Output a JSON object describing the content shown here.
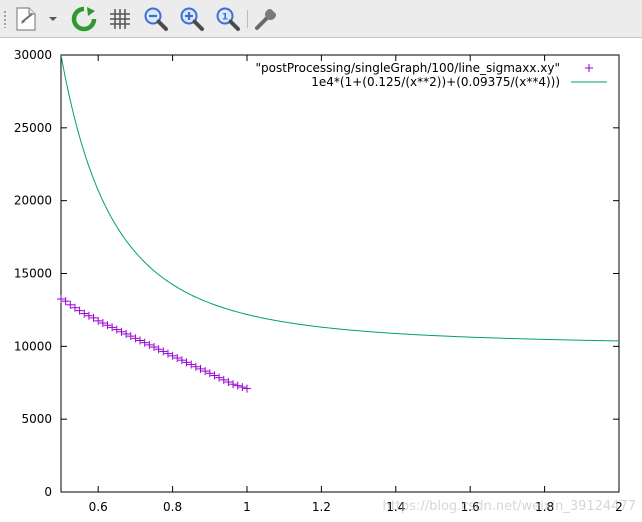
{
  "toolbar": {
    "buttons": [
      {
        "name": "export-button",
        "icon": "page-export-icon"
      },
      {
        "name": "export-menu-button",
        "icon": "chevron-down-icon"
      },
      {
        "name": "replot-button",
        "icon": "refresh-icon"
      },
      {
        "name": "grid-button",
        "icon": "grid-icon"
      },
      {
        "name": "zoom-out-button",
        "icon": "zoom-out-icon"
      },
      {
        "name": "zoom-in-button",
        "icon": "zoom-in-icon"
      },
      {
        "name": "zoom-reset-button",
        "icon": "zoom-reset-icon"
      },
      {
        "name": "settings-button",
        "icon": "wrench-icon"
      }
    ],
    "colors": {
      "refresh": "#2e9a2e",
      "zoom": "#3b6fd1"
    }
  },
  "watermark": "https://blog.csdn.net/weixin_39124477",
  "chart_data": {
    "type": "scatter",
    "xlim": [
      0.5,
      2.0
    ],
    "ylim": [
      0,
      30000
    ],
    "xticks": [
      0.6,
      0.8,
      1.0,
      1.2,
      1.4,
      1.6,
      1.8,
      2.0
    ],
    "xtick_labels": [
      "0.6",
      "0.8",
      "1",
      "1.2",
      "1.4",
      "1.6",
      "1.8",
      "2"
    ],
    "yticks": [
      0,
      5000,
      10000,
      15000,
      20000,
      25000,
      30000
    ],
    "ytick_labels": [
      "0",
      "5000",
      "10000",
      "15000",
      "20000",
      "25000",
      "30000"
    ],
    "grid": false,
    "legend_position": "top-right",
    "series": [
      {
        "name": "\"postProcessing/singleGraph/100/line_sigmaxx.xy\"",
        "kind": "points",
        "marker": "plus",
        "color": "#9400d3",
        "x": [
          0.5,
          0.5125,
          0.525,
          0.5375,
          0.55,
          0.5625,
          0.575,
          0.5875,
          0.6,
          0.6125,
          0.625,
          0.6375,
          0.65,
          0.6625,
          0.675,
          0.6875,
          0.7,
          0.7125,
          0.725,
          0.7375,
          0.75,
          0.7625,
          0.775,
          0.7875,
          0.8,
          0.8125,
          0.825,
          0.8375,
          0.85,
          0.8625,
          0.875,
          0.8875,
          0.9,
          0.9125,
          0.925,
          0.9375,
          0.95,
          0.9625,
          0.975,
          0.9875,
          1.0
        ],
        "y": [
          13250,
          13100,
          12850,
          12650,
          12450,
          12250,
          12100,
          11950,
          11750,
          11600,
          11450,
          11300,
          11150,
          11000,
          10850,
          10700,
          10550,
          10400,
          10250,
          10100,
          9950,
          9800,
          9650,
          9500,
          9350,
          9200,
          9050,
          8900,
          8750,
          8600,
          8450,
          8300,
          8150,
          8000,
          7850,
          7700,
          7550,
          7400,
          7300,
          7200,
          7100
        ]
      },
      {
        "name": "1e4*(1+(0.125/(x**2))+(0.09375/(x**4)))",
        "kind": "line",
        "color": "#009e73",
        "function": "1e4*(1+(0.125/(x**2))+(0.09375/(x**4)))"
      }
    ]
  }
}
